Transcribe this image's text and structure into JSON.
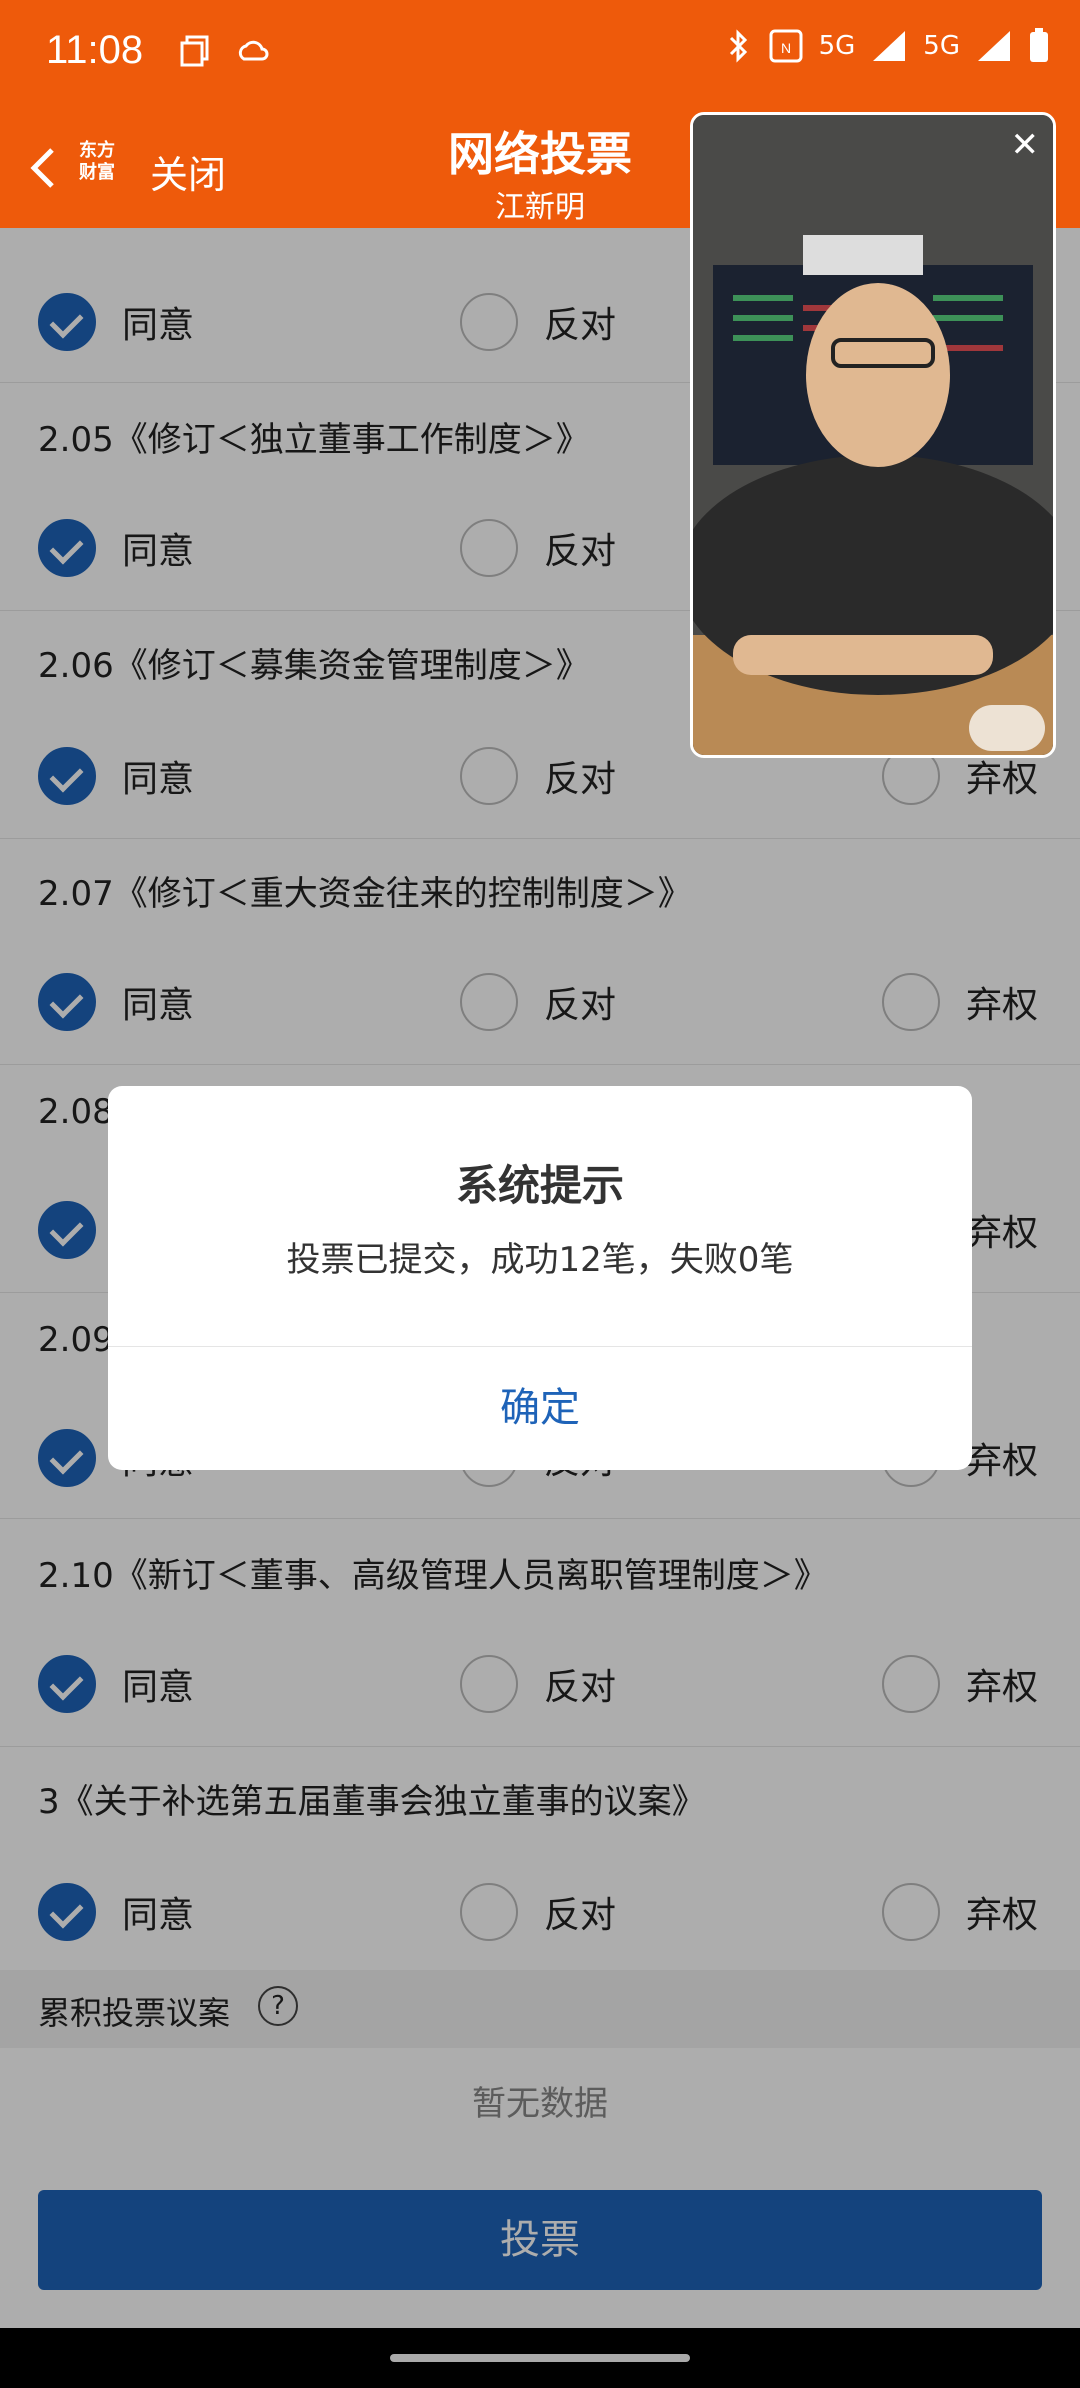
{
  "status_bar": {
    "time": "11:08",
    "net1": "5G",
    "net2": "5G"
  },
  "header": {
    "close_label": "关闭",
    "title": "网络投票",
    "subtitle": "江新明",
    "logo_text": "东方财富"
  },
  "options": {
    "agree": "同意",
    "oppose": "反对",
    "abstain": "弃权"
  },
  "items": [
    {
      "title": "",
      "selected": "agree"
    },
    {
      "title": "2.05《修订＜独立董事工作制度＞》",
      "selected": "agree"
    },
    {
      "title": "2.06《修订＜募集资金管理制度＞》",
      "selected": "agree"
    },
    {
      "title": "2.07《修订＜重大资金往来的控制制度＞》",
      "selected": "agree"
    },
    {
      "title": "2.08",
      "selected": "agree"
    },
    {
      "title": "2.09",
      "selected": "agree"
    },
    {
      "title": "2.10《新订＜董事、高级管理人员离职管理制度＞》",
      "selected": "agree"
    },
    {
      "title": "3《关于补选第五届董事会独立董事的议案》",
      "selected": "agree"
    }
  ],
  "section": {
    "label": "累积投票议案",
    "help_icon": "?"
  },
  "no_data": "暂无数据",
  "vote_button": "投票",
  "dialog": {
    "title": "系统提示",
    "message": "投票已提交，成功12笔，失败0笔",
    "confirm": "确定"
  },
  "colors": {
    "brand": "#ee5a0b",
    "accent": "#1e63b8"
  }
}
